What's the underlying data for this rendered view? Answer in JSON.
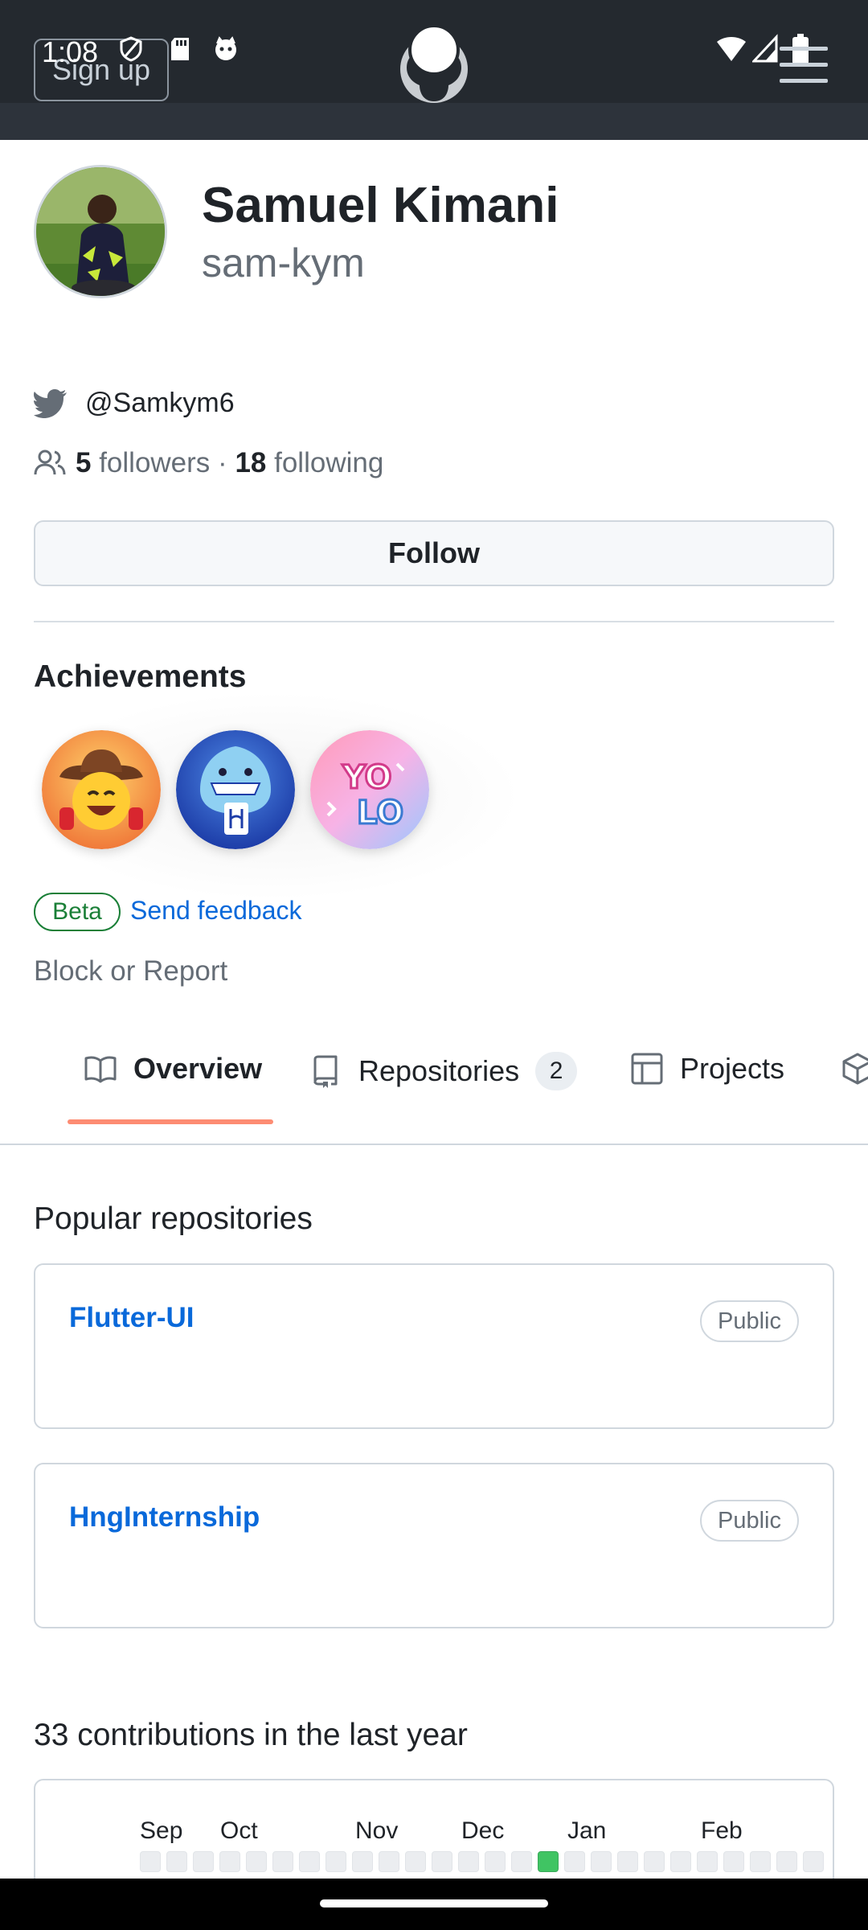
{
  "status_bar": {
    "time": "1:08"
  },
  "header": {
    "sign_up_label": "Sign up",
    "logo_icon": "github-mark-icon",
    "menu_icon": "hamburger-menu-icon"
  },
  "profile": {
    "name": "Samuel Kimani",
    "login": "sam-kym",
    "twitter": "@Samkym6",
    "followers_count": "5",
    "followers_label": "followers",
    "separator": "·",
    "following_count": "18",
    "following_label": "following",
    "follow_button": "Follow"
  },
  "achievements": {
    "title": "Achievements",
    "badges": [
      "pull-shark-icon",
      "quickdraw-icon",
      "yolo-icon"
    ],
    "beta_label": "Beta",
    "feedback_label": "Send feedback"
  },
  "block_report": "Block or Report",
  "tabs": [
    {
      "label": "Overview",
      "icon": "book-icon",
      "selected": true
    },
    {
      "label": "Repositories",
      "icon": "repo-icon",
      "count": "2"
    },
    {
      "label": "Projects",
      "icon": "table-icon"
    },
    {
      "label": "",
      "icon": "package-icon"
    }
  ],
  "popular": {
    "title": "Popular repositories",
    "repos": [
      {
        "name": "Flutter-UI",
        "visibility": "Public"
      },
      {
        "name": "HngInternship",
        "visibility": "Public"
      }
    ]
  },
  "contributions": {
    "title": "33 contributions in the last year",
    "months": [
      "Sep",
      "Oct",
      "Nov",
      "Dec",
      "Jan",
      "Feb"
    ],
    "week_levels": [
      0,
      0,
      0,
      0,
      0,
      0,
      0,
      0,
      0,
      0,
      0,
      0,
      0,
      0,
      0,
      2,
      0,
      0,
      0,
      0,
      0,
      0,
      0,
      0,
      0,
      0
    ]
  },
  "colors": {
    "header_bg": "#24292f",
    "link": "#0969da",
    "tab_underline": "#fd8c73",
    "beta_green": "#1a7f37",
    "contrib_green": "#40c463"
  }
}
